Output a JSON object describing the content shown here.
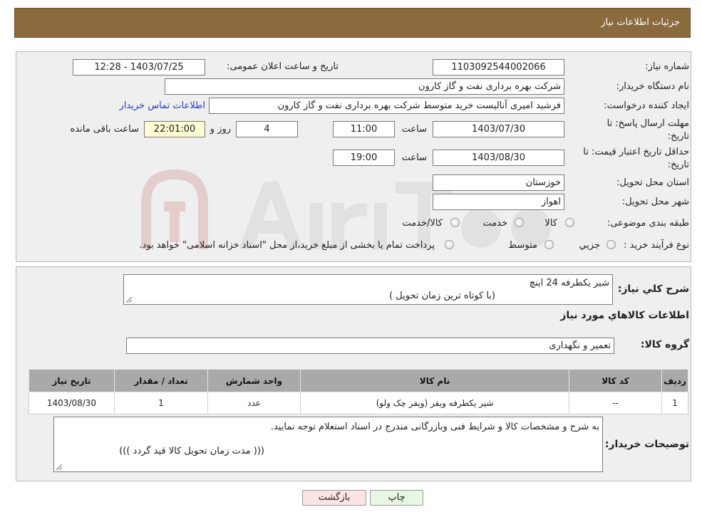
{
  "header": {
    "title": "جزئیات اطلاعات نیاز"
  },
  "fields": {
    "need_number_label": "شماره نیاز:",
    "need_number": "1103092544002066",
    "announce_label": "تاریخ و ساعت اعلان عمومی:",
    "announce_value": "1403/07/25 - 12:28",
    "buyer_org_label": "نام دستگاه خریدار:",
    "buyer_org": "شرکت بهره برداری نفت و گاز کارون",
    "creator_label": "ایجاد کننده درخواست:",
    "creator": "فرشید امیری آنالیست خرید متوسط شرکت بهره برداری نفت و گاز کارون",
    "contact_link": "اطلاعات تماس خریدار",
    "deadline_label_line1": "مهلت ارسال پاسخ: تا",
    "deadline_label_line2": "تاریخ:",
    "deadline_date": "1403/07/30",
    "time_label": "ساعت",
    "deadline_time": "11:00",
    "days_value": "4",
    "days_label": "روز و",
    "remaining_time": "22:01:00",
    "remaining_label": "ساعت باقی مانده",
    "validity_label_line1": "حداقل تاریخ اعتبار قیمت: تا",
    "validity_label_line2": "تاریخ:",
    "validity_date": "1403/08/30",
    "validity_time": "19:00",
    "province_label": "استان محل تحویل:",
    "province": "خوزستان",
    "city_label": "شهر محل تحویل:",
    "city": "اهواز",
    "category_label": "طبقه بندی موضوعی:",
    "category_options": [
      "کالا",
      "خدمت",
      "کالا/خدمت"
    ],
    "process_label": "نوع فرآیند خرید :",
    "process_options": [
      "جزیي",
      "متوسط"
    ],
    "process_note": "پرداخت تمام یا بخشی از مبلغ خرید،از محل \"اسناد خزانه اسلامی\" خواهد بود."
  },
  "description": {
    "label": "شرح کلي نياز:",
    "line1": "شیر یکطرفه 24 اینچ",
    "line2": "(با کوتاه ترین زمان تحویل )"
  },
  "goods_info_title": "اطلاعات کالاهاي مورد نياز",
  "goods_group": {
    "label": "گروه کالا:",
    "value": "تعمیر و نگهداری"
  },
  "table": {
    "headers": [
      "ردیف",
      "کد کالا",
      "نام کالا",
      "واحد شمارش",
      "تعداد / مقدار",
      "تاریخ نیاز"
    ],
    "rows": [
      [
        "1",
        "--",
        "شیر یکطرفه ویفر (ویفر چک ولو)",
        "عدد",
        "1",
        "1403/08/30"
      ]
    ]
  },
  "buyer_notes": {
    "label": "توضیحات خریدار:",
    "line1": "به شرح و مشخصات کالا و شرایط فنی وبازرگانی مندرج در اسناد استعلام توجه نمایید.",
    "line2": "(((   مدت زمان تحویل کالا قید گردد   )))"
  },
  "buttons": {
    "back": "بازگشت",
    "print": "چاپ"
  },
  "colors": {
    "header": "#8b6a3e",
    "panel": "#efefef",
    "link": "#1b3ec9",
    "back_button": "#fde3e3",
    "print_button": "#e8f7e3"
  }
}
